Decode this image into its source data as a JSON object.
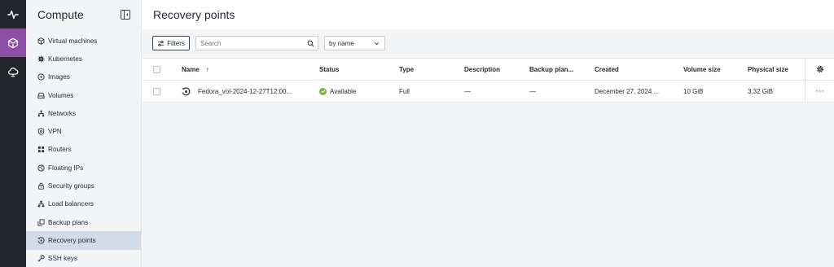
{
  "rail": {
    "items": [
      {
        "icon": "activity-icon"
      },
      {
        "icon": "cube-icon",
        "active": true
      },
      {
        "icon": "cloud-icon"
      }
    ]
  },
  "sidebar": {
    "title": "Compute",
    "items": [
      {
        "label": "Virtual machines",
        "icon": "cube-icon"
      },
      {
        "label": "Kubernetes",
        "icon": "kubernetes-icon"
      },
      {
        "label": "Images",
        "icon": "disc-icon"
      },
      {
        "label": "Volumes",
        "icon": "drive-icon"
      },
      {
        "label": "Networks",
        "icon": "network-icon"
      },
      {
        "label": "VPN",
        "icon": "shield-icon"
      },
      {
        "label": "Routers",
        "icon": "router-icon"
      },
      {
        "label": "Floating IPs",
        "icon": "globe-icon"
      },
      {
        "label": "Security groups",
        "icon": "lock-icon"
      },
      {
        "label": "Load balancers",
        "icon": "hierarchy-icon"
      },
      {
        "label": "Backup plans",
        "icon": "copy-icon"
      },
      {
        "label": "Recovery points",
        "icon": "restore-icon",
        "active": true
      },
      {
        "label": "SSH keys",
        "icon": "key-icon"
      }
    ]
  },
  "page": {
    "title": "Recovery points"
  },
  "toolbar": {
    "filters_label": "Filters",
    "search_placeholder": "Search",
    "sort_value": "by name"
  },
  "table": {
    "headers": {
      "name": "Name",
      "status": "Status",
      "type": "Type",
      "description": "Description",
      "backup_plan": "Backup plan...",
      "created": "Created",
      "volume_size": "Volume size",
      "physical_size": "Physical size"
    },
    "sort_indicator": "↑",
    "rows": [
      {
        "name": "Fedora_vol-2024-12-27T12:00...",
        "status": "Available",
        "type": "Full",
        "description": "—",
        "backup_plan": "—",
        "created": "December 27, 2024 ...",
        "volume_size": "10 GiB",
        "physical_size": "3.32 GiB",
        "actions": "···"
      }
    ]
  },
  "colors": {
    "accent": "#8c4fa6",
    "rail_bg": "#22262b",
    "sidebar_bg": "#f3f4f6",
    "active_item_bg": "#d2dce8",
    "status_available": "#7fb23a"
  }
}
